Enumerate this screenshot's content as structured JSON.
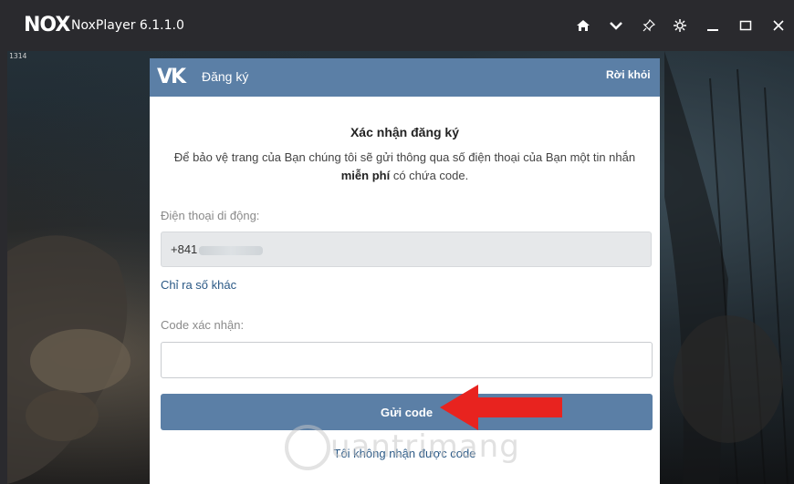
{
  "window": {
    "logo": "NOX",
    "title": "NoxPlayer 6.1.1.0",
    "controls": [
      "home-icon",
      "chevron-down-icon",
      "pin-icon",
      "gear-icon",
      "minimize-icon",
      "maximize-icon",
      "close-icon"
    ]
  },
  "overlay": {
    "fps": "1314"
  },
  "dialog": {
    "header": {
      "logo": "VK",
      "title": "Đăng ký",
      "exit_label": "Rời khỏi"
    },
    "title": "Xác nhận đăng ký",
    "description_part1": "Để bảo vệ trang của Bạn chúng tôi sẽ gửi thông qua số điện thoại của Bạn một tin nhắn ",
    "description_bold": "miễn phí",
    "description_part2": " có chứa code.",
    "phone_label": "Điện thoại di động:",
    "phone_value": "+841",
    "change_number_link": "Chỉ ra số khác",
    "code_label": "Code xác nhận:",
    "code_value": "",
    "send_button": "Gửi code",
    "no_code_link": "Tôi không nhận được code"
  },
  "annotation": {
    "arrow_color": "#e8231f"
  },
  "watermark": {
    "text": "uantrimang"
  },
  "colors": {
    "vk_blue": "#5b7fa6",
    "link_blue": "#2a5885",
    "titlebar": "#2a2a2e"
  }
}
